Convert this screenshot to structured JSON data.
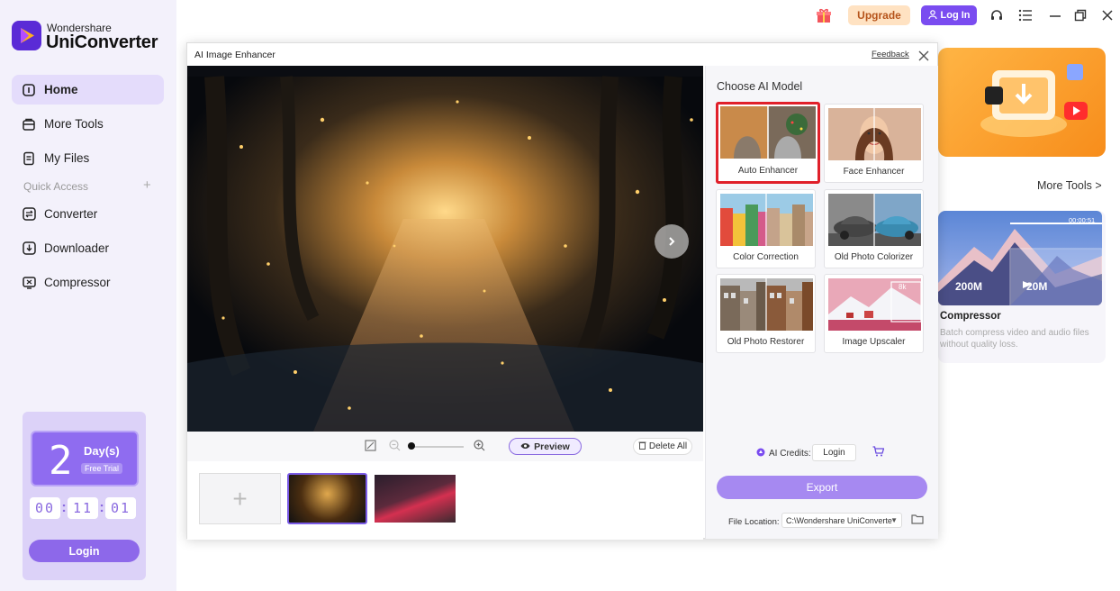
{
  "app": {
    "brand_line1": "Wondershare",
    "brand_line2": "UniConverter"
  },
  "sidebar": {
    "items": [
      {
        "label": "Home",
        "icon": "home-icon"
      },
      {
        "label": "More Tools",
        "icon": "toolbox-icon"
      },
      {
        "label": "My Files",
        "icon": "file-icon"
      }
    ],
    "quick_access_label": "Quick Access",
    "quick_items": [
      {
        "label": "Converter",
        "icon": "converter-icon"
      },
      {
        "label": "Downloader",
        "icon": "downloader-icon"
      },
      {
        "label": "Compressor",
        "icon": "compressor-icon"
      }
    ]
  },
  "trial": {
    "number": "2",
    "days_label": "Day(s)",
    "free_label": "Free Trial",
    "timer": [
      "00",
      "11",
      "01"
    ],
    "login_label": "Login"
  },
  "topbar": {
    "upgrade_label": "Upgrade",
    "login_label": "Log In"
  },
  "right_panel": {
    "more_tools_label": "More Tools",
    "compressor_card": {
      "title": "Compressor",
      "description": "Batch compress video and audio files without quality loss.",
      "from_size": "200M",
      "to_size": "20M",
      "time": "00:00:51"
    }
  },
  "dialog": {
    "title": "AI Image Enhancer",
    "feedback_label": "Feedback",
    "preview_label": "Preview",
    "delete_all_label": "Delete All",
    "choose_model_title": "Choose AI Model",
    "models": [
      {
        "label": "Auto Enhancer",
        "selected": true
      },
      {
        "label": "Face Enhancer",
        "selected": false
      },
      {
        "label": "Color Correction",
        "selected": false
      },
      {
        "label": "Old Photo Colorizer",
        "selected": false
      },
      {
        "label": "Old Photo Restorer",
        "selected": false
      },
      {
        "label": "Image Upscaler",
        "selected": false
      }
    ],
    "credits_label": "AI Credits:",
    "credits_login_label": "Login",
    "export_label": "Export",
    "file_location_label": "File Location:",
    "file_location_value": "C:\\Wondershare UniConverte",
    "upscale_badge": "8k"
  },
  "colors": {
    "accent": "#7a4cf0",
    "selected_border": "#e0202a",
    "upgrade_bg": "#ffe2c2"
  }
}
